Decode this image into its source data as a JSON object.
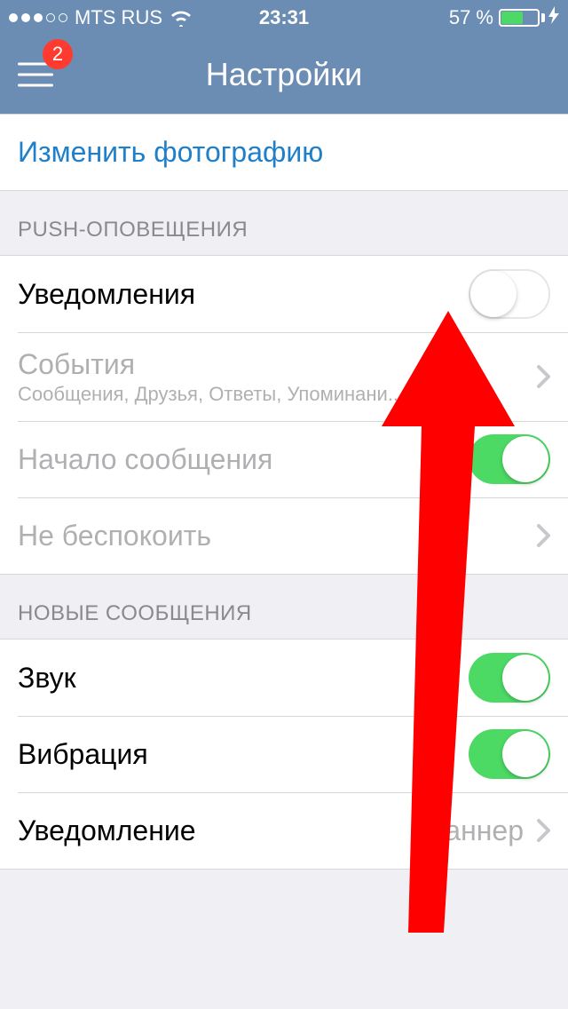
{
  "status": {
    "carrier": "MTS RUS",
    "time": "23:31",
    "battery_percent": "57 %"
  },
  "nav": {
    "title": "Настройки",
    "badge": "2"
  },
  "link": {
    "change_photo": "Изменить фотографию"
  },
  "sections": {
    "push": {
      "header": "PUSH-ОПОВЕЩЕНИЯ",
      "notifications": "Уведомления",
      "events": "События",
      "events_sub": "Сообщения, Друзья, Ответы, Упоминани...",
      "message_start": "Начало сообщения",
      "dnd": "Не беспокоить"
    },
    "new_messages": {
      "header": "НОВЫЕ СООБЩЕНИЯ",
      "sound": "Звук",
      "vibration": "Вибрация",
      "alert": "Уведомление",
      "alert_value": "Баннер"
    }
  }
}
